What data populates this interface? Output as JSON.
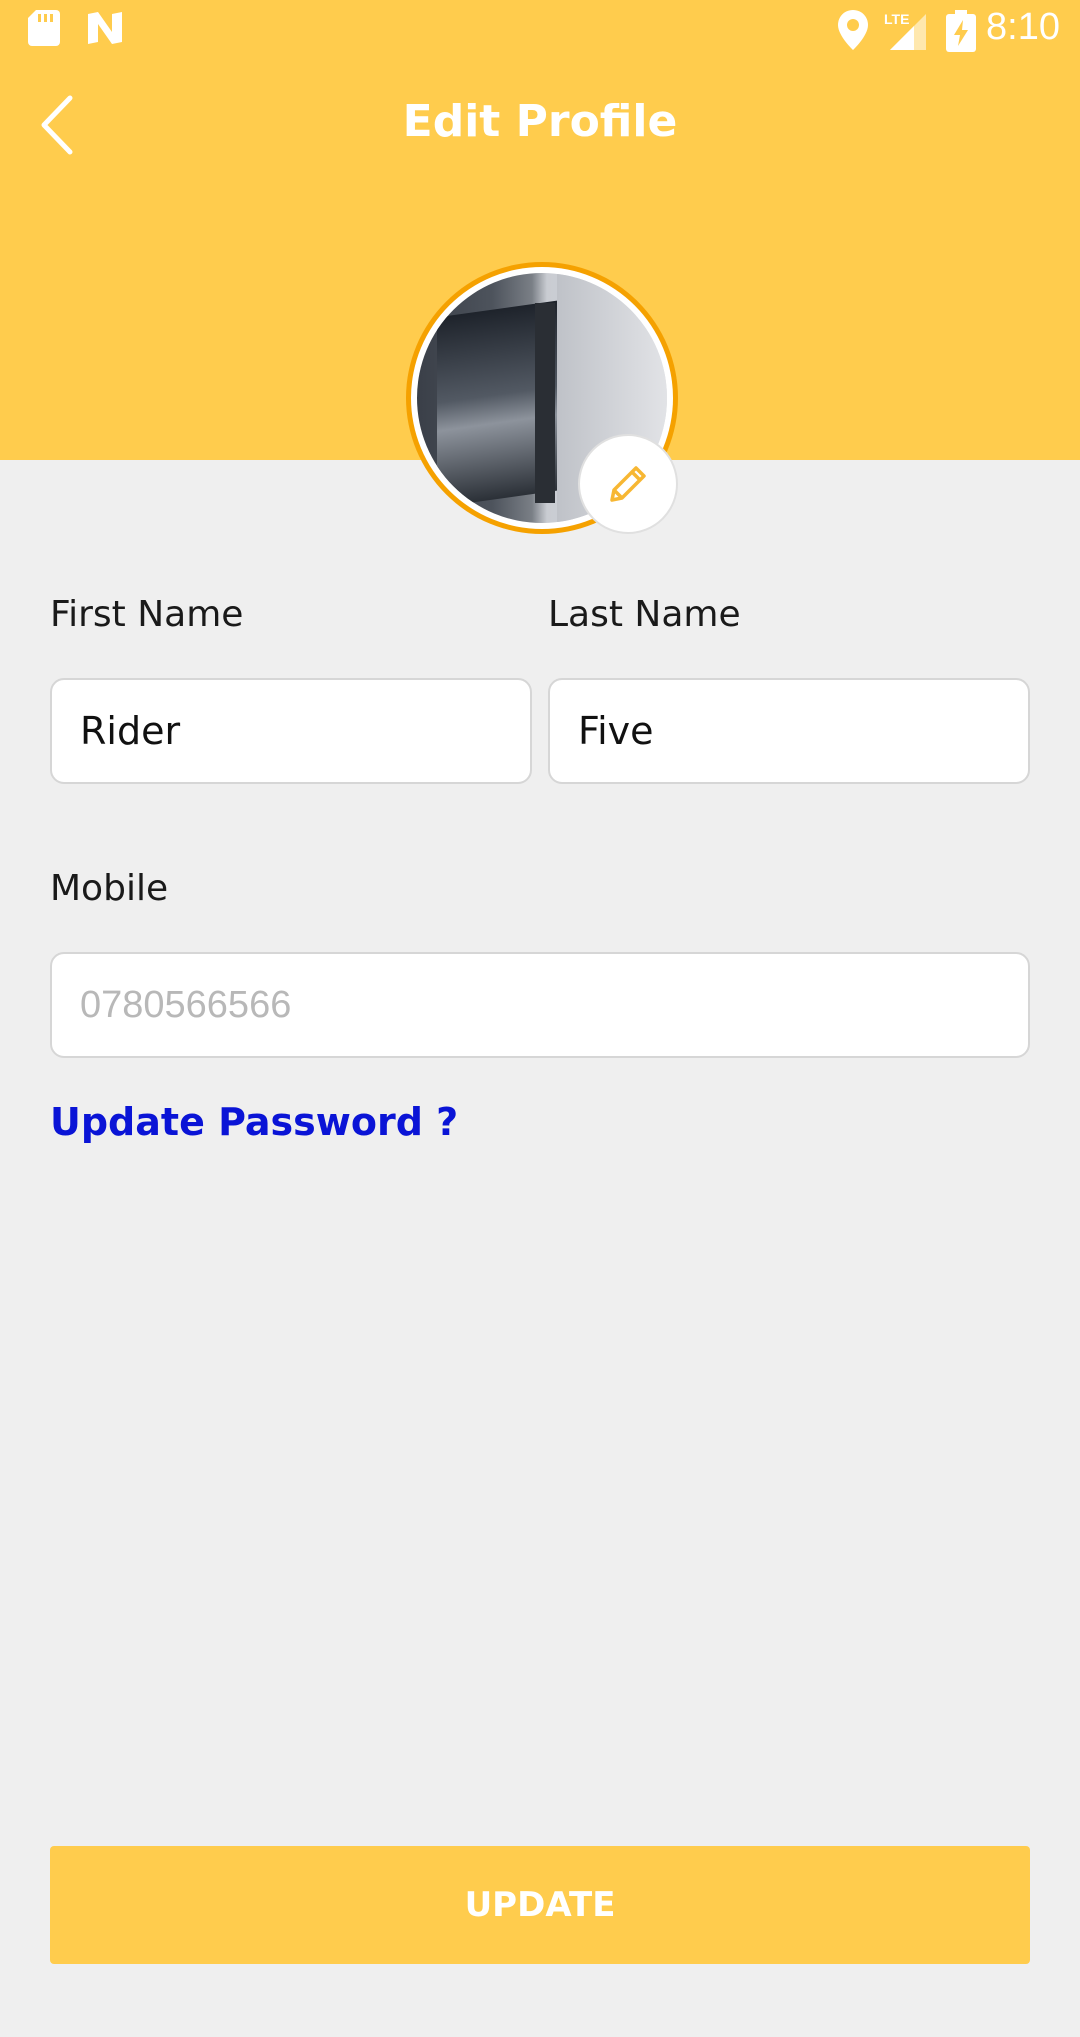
{
  "status_bar": {
    "time": "8:10",
    "icons": [
      "sd-card-icon",
      "n-notification-icon",
      "location-icon",
      "lte-signal-icon",
      "battery-charging-icon"
    ],
    "network_label": "LTE"
  },
  "toolbar": {
    "title": "Edit Profile",
    "back_icon": "chevron-left-icon"
  },
  "avatar": {
    "edit_icon": "pencil-icon",
    "ring_color": "#f5a100"
  },
  "form": {
    "first_name_label": "First Name",
    "first_name_value": "Rider",
    "last_name_label": "Last Name",
    "last_name_value": "Five",
    "mobile_label": "Mobile",
    "mobile_value": "0780566566"
  },
  "update_password_link": "Update Password ?",
  "update_button": "UPDATE",
  "colors": {
    "header": "#ffcc4d",
    "background": "#efefef",
    "link": "#0a14d6"
  }
}
